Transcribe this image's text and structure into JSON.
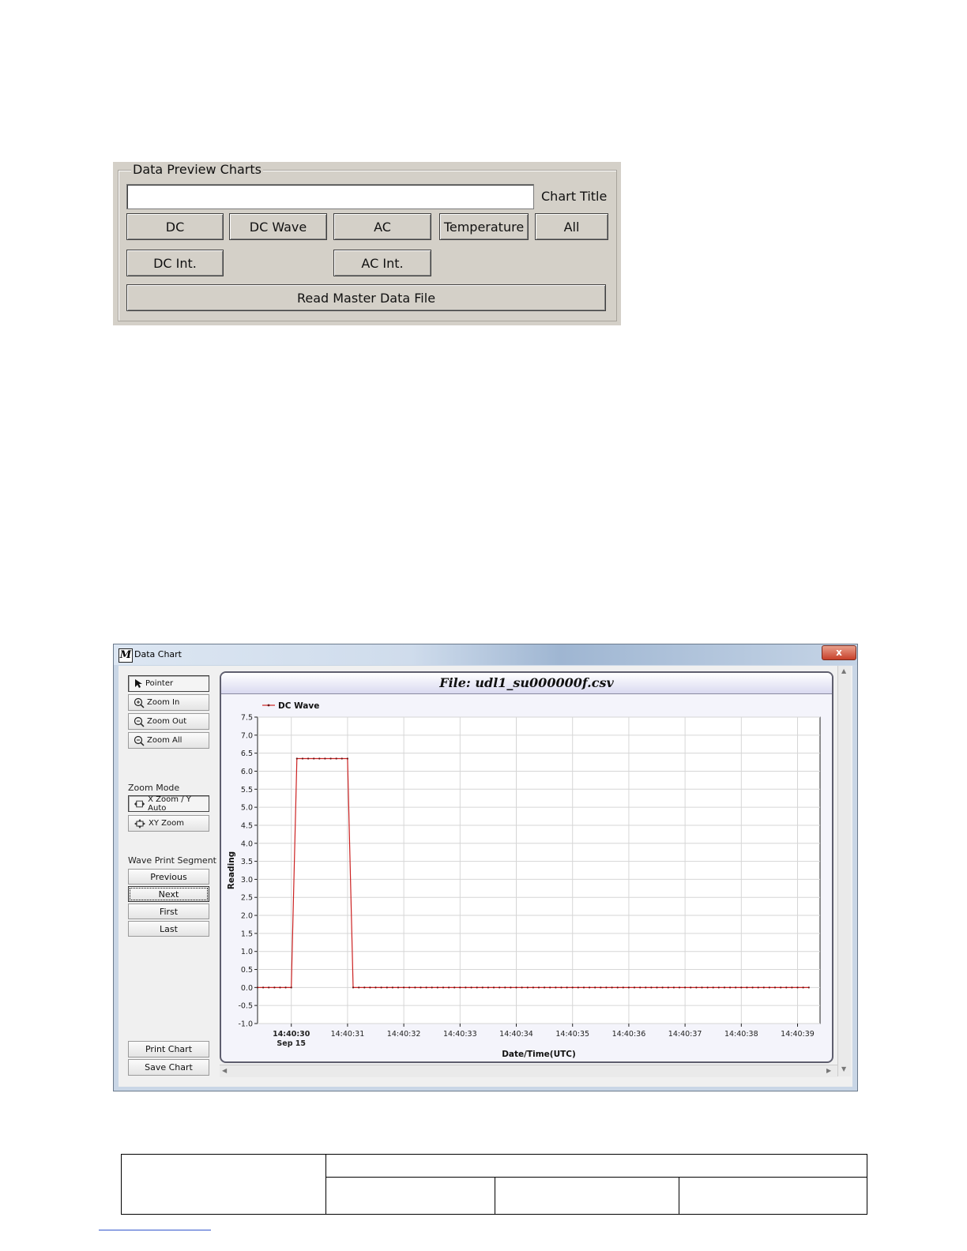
{
  "preview_panel": {
    "group_title": "Data Preview Charts",
    "chart_title_value": "",
    "chart_title_label": "Chart Title",
    "buttons": {
      "dc": "DC",
      "dc_wave": "DC Wave",
      "ac": "AC",
      "temperature": "Temperature",
      "all": "All",
      "dc_int": "DC Int.",
      "ac_int": "AC Int.",
      "read_master": "Read Master Data File"
    }
  },
  "window": {
    "title": "Data Chart",
    "close_label": "x",
    "tools": {
      "pointer": "Pointer",
      "zoom_in": "Zoom In",
      "zoom_out": "Zoom Out",
      "zoom_all": "Zoom All"
    },
    "zoom_mode": {
      "label": "Zoom Mode",
      "x_zoom": "X Zoom / Y Auto",
      "xy_zoom": "XY Zoom"
    },
    "wave_segment": {
      "label": "Wave Print Segment",
      "previous": "Previous",
      "next": "Next",
      "first": "First",
      "last": "Last"
    },
    "print_chart": "Print Chart",
    "save_chart": "Save Chart",
    "chart_header": "File: udl1_su000000f.csv"
  },
  "chart_data": {
    "type": "line",
    "xlabel": "Date/Time(UTC)",
    "ylabel": "Reading",
    "ylim": [
      -1.0,
      7.5
    ],
    "yticks": [
      "7.5",
      "7.0",
      "6.5",
      "6.0",
      "5.5",
      "5.0",
      "4.5",
      "4.0",
      "3.5",
      "3.0",
      "2.5",
      "2.0",
      "1.5",
      "1.0",
      "0.5",
      "0.0",
      "-0.5",
      "-1.0"
    ],
    "xticks": [
      "14:40:30",
      "14:40:31",
      "14:40:32",
      "14:40:33",
      "14:40:34",
      "14:40:35",
      "14:40:36",
      "14:40:37",
      "14:40:38",
      "14:40:39"
    ],
    "xtick_sublabel": "Sep 15",
    "xlim": [
      "14:40:29.4",
      "14:40:39.4"
    ],
    "grid": true,
    "legend_position": "top-left",
    "series": [
      {
        "name": "DC Wave",
        "color": "#cc2222",
        "segments": [
          {
            "from": "14:40:29.4",
            "to": "14:40:30.0",
            "value": 0.0
          },
          {
            "from": "14:40:30.1",
            "to": "14:40:31.0",
            "value": 6.35
          },
          {
            "from": "14:40:31.1",
            "to": "14:40:39.2",
            "value": 0.0
          }
        ],
        "sample_interval_s": 0.1
      }
    ]
  },
  "footer_table": {
    "rows": [
      [
        "",
        ""
      ],
      [
        "",
        "",
        ""
      ]
    ]
  }
}
